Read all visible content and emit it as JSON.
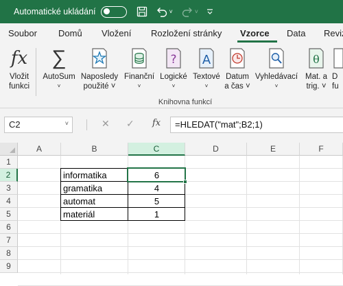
{
  "titlebar": {
    "autosave_label": "Automatické ukládání",
    "icons": [
      "toggle-switch",
      "save-icon",
      "undo-icon",
      "redo-icon",
      "customize-icon"
    ]
  },
  "tabs": [
    "Soubor",
    "Domů",
    "Vložení",
    "Rozložení stránky",
    "Vzorce",
    "Data",
    "Revize"
  ],
  "active_tab": "Vzorce",
  "ribbon": {
    "buttons": [
      {
        "line1": "Vložit",
        "line2": "funkci",
        "icon": "fx-icon"
      },
      {
        "line1": "AutoSum",
        "line2": "˅",
        "icon": "sigma-icon"
      },
      {
        "line1": "Naposledy",
        "line2": "použité ˅",
        "icon": "star-icon"
      },
      {
        "line1": "Finanční",
        "line2": "˅",
        "icon": "finance-icon"
      },
      {
        "line1": "Logické",
        "line2": "˅",
        "icon": "logical-icon"
      },
      {
        "line1": "Textové",
        "line2": "˅",
        "icon": "text-icon"
      },
      {
        "line1": "Datum",
        "line2": "a čas ˅",
        "icon": "datetime-icon"
      },
      {
        "line1": "Vyhledávací",
        "line2": "˅",
        "icon": "lookup-icon"
      },
      {
        "line1": "Mat. a",
        "line2": "trig. ˅",
        "icon": "math-icon"
      },
      {
        "line1": "D",
        "line2": "fu",
        "icon": "more-functions-icon"
      }
    ],
    "group_label": "Knihovna funkcí"
  },
  "formula_bar": {
    "name_box": "C2",
    "fx_label": "fx",
    "formula": "=HLEDAT(\"mat\";B2;1)"
  },
  "grid": {
    "columns": [
      "A",
      "B",
      "C",
      "D",
      "E",
      "F"
    ],
    "rows": [
      "1",
      "2",
      "3",
      "4",
      "5",
      "6",
      "7",
      "8",
      "9"
    ],
    "selected_cell": "C2",
    "table": [
      {
        "word": "informatika",
        "value": "6"
      },
      {
        "word": "gramatika",
        "value": "4"
      },
      {
        "word": "automat",
        "value": "5"
      },
      {
        "word": "materiál",
        "value": "1"
      }
    ]
  },
  "colors": {
    "accent": "#217346",
    "selection_header": "#d3f0e0"
  }
}
